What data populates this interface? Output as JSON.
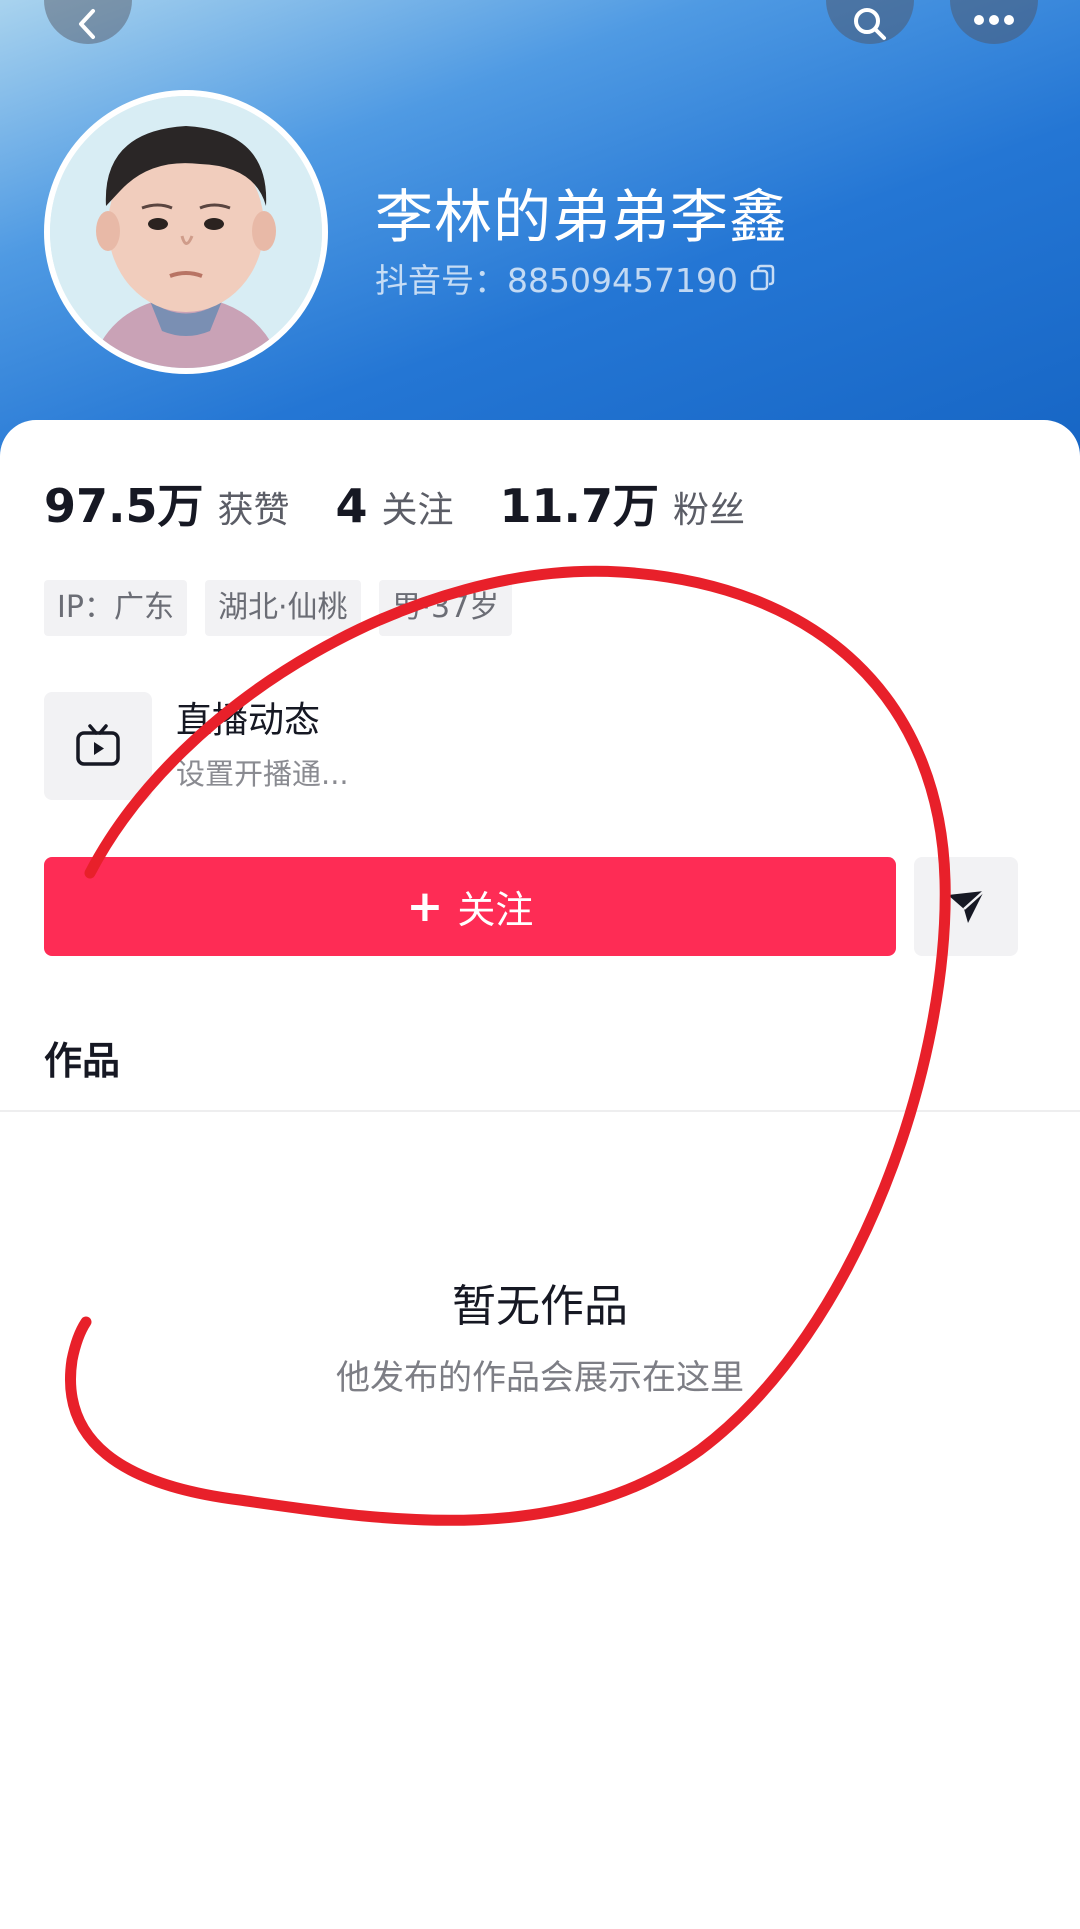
{
  "header": {
    "back_icon": "chevron-left-icon",
    "search_icon": "search-icon",
    "more_icon": "more-dots-icon"
  },
  "profile": {
    "nickname": "李林的弟弟李鑫",
    "douyin_id": "抖音号：88509457190",
    "copy_icon": "copy-icon"
  },
  "stats": [
    {
      "number": "97.5万",
      "label": "获赞"
    },
    {
      "number": "4",
      "label": "关注"
    },
    {
      "number": "11.7万",
      "label": "粉丝"
    }
  ],
  "tags": [
    "IP：广东",
    "湖北·仙桃",
    "男·37岁"
  ],
  "live": {
    "icon": "tv-play-icon",
    "title": "直播动态",
    "subtitle": "设置开播通..."
  },
  "actions": {
    "follow_label": "关注",
    "follow_plus": "+",
    "message_icon": "send-icon",
    "follow_color": "#fe2c55"
  },
  "works": {
    "tab_label": "作品",
    "empty_title": "暂无作品",
    "empty_subtitle": "他发布的作品会展示在这里"
  },
  "annotation": {
    "color": "#e8202a"
  }
}
